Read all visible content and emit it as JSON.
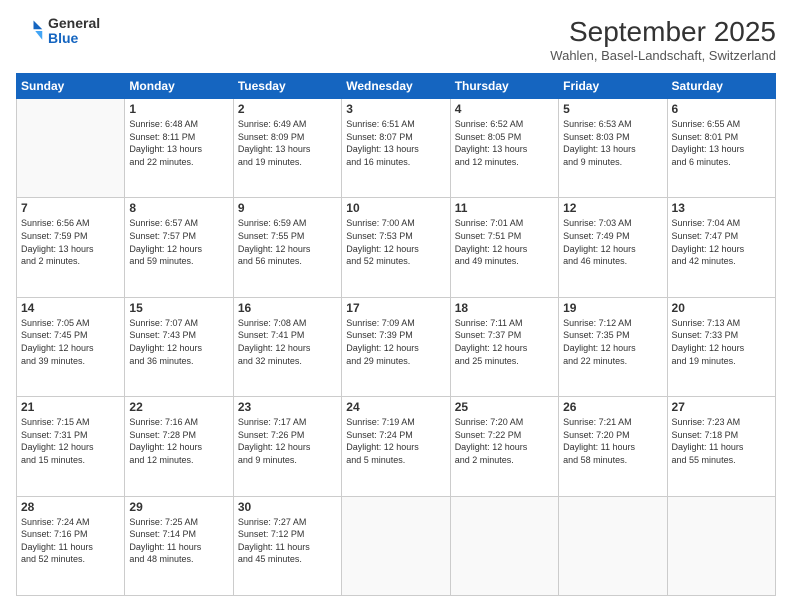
{
  "header": {
    "logo_general": "General",
    "logo_blue": "Blue",
    "month_title": "September 2025",
    "location": "Wahlen, Basel-Landschaft, Switzerland"
  },
  "columns": [
    "Sunday",
    "Monday",
    "Tuesday",
    "Wednesday",
    "Thursday",
    "Friday",
    "Saturday"
  ],
  "weeks": [
    [
      {
        "day": "",
        "info": ""
      },
      {
        "day": "1",
        "info": "Sunrise: 6:48 AM\nSunset: 8:11 PM\nDaylight: 13 hours\nand 22 minutes."
      },
      {
        "day": "2",
        "info": "Sunrise: 6:49 AM\nSunset: 8:09 PM\nDaylight: 13 hours\nand 19 minutes."
      },
      {
        "day": "3",
        "info": "Sunrise: 6:51 AM\nSunset: 8:07 PM\nDaylight: 13 hours\nand 16 minutes."
      },
      {
        "day": "4",
        "info": "Sunrise: 6:52 AM\nSunset: 8:05 PM\nDaylight: 13 hours\nand 12 minutes."
      },
      {
        "day": "5",
        "info": "Sunrise: 6:53 AM\nSunset: 8:03 PM\nDaylight: 13 hours\nand 9 minutes."
      },
      {
        "day": "6",
        "info": "Sunrise: 6:55 AM\nSunset: 8:01 PM\nDaylight: 13 hours\nand 6 minutes."
      }
    ],
    [
      {
        "day": "7",
        "info": "Sunrise: 6:56 AM\nSunset: 7:59 PM\nDaylight: 13 hours\nand 2 minutes."
      },
      {
        "day": "8",
        "info": "Sunrise: 6:57 AM\nSunset: 7:57 PM\nDaylight: 12 hours\nand 59 minutes."
      },
      {
        "day": "9",
        "info": "Sunrise: 6:59 AM\nSunset: 7:55 PM\nDaylight: 12 hours\nand 56 minutes."
      },
      {
        "day": "10",
        "info": "Sunrise: 7:00 AM\nSunset: 7:53 PM\nDaylight: 12 hours\nand 52 minutes."
      },
      {
        "day": "11",
        "info": "Sunrise: 7:01 AM\nSunset: 7:51 PM\nDaylight: 12 hours\nand 49 minutes."
      },
      {
        "day": "12",
        "info": "Sunrise: 7:03 AM\nSunset: 7:49 PM\nDaylight: 12 hours\nand 46 minutes."
      },
      {
        "day": "13",
        "info": "Sunrise: 7:04 AM\nSunset: 7:47 PM\nDaylight: 12 hours\nand 42 minutes."
      }
    ],
    [
      {
        "day": "14",
        "info": "Sunrise: 7:05 AM\nSunset: 7:45 PM\nDaylight: 12 hours\nand 39 minutes."
      },
      {
        "day": "15",
        "info": "Sunrise: 7:07 AM\nSunset: 7:43 PM\nDaylight: 12 hours\nand 36 minutes."
      },
      {
        "day": "16",
        "info": "Sunrise: 7:08 AM\nSunset: 7:41 PM\nDaylight: 12 hours\nand 32 minutes."
      },
      {
        "day": "17",
        "info": "Sunrise: 7:09 AM\nSunset: 7:39 PM\nDaylight: 12 hours\nand 29 minutes."
      },
      {
        "day": "18",
        "info": "Sunrise: 7:11 AM\nSunset: 7:37 PM\nDaylight: 12 hours\nand 25 minutes."
      },
      {
        "day": "19",
        "info": "Sunrise: 7:12 AM\nSunset: 7:35 PM\nDaylight: 12 hours\nand 22 minutes."
      },
      {
        "day": "20",
        "info": "Sunrise: 7:13 AM\nSunset: 7:33 PM\nDaylight: 12 hours\nand 19 minutes."
      }
    ],
    [
      {
        "day": "21",
        "info": "Sunrise: 7:15 AM\nSunset: 7:31 PM\nDaylight: 12 hours\nand 15 minutes."
      },
      {
        "day": "22",
        "info": "Sunrise: 7:16 AM\nSunset: 7:28 PM\nDaylight: 12 hours\nand 12 minutes."
      },
      {
        "day": "23",
        "info": "Sunrise: 7:17 AM\nSunset: 7:26 PM\nDaylight: 12 hours\nand 9 minutes."
      },
      {
        "day": "24",
        "info": "Sunrise: 7:19 AM\nSunset: 7:24 PM\nDaylight: 12 hours\nand 5 minutes."
      },
      {
        "day": "25",
        "info": "Sunrise: 7:20 AM\nSunset: 7:22 PM\nDaylight: 12 hours\nand 2 minutes."
      },
      {
        "day": "26",
        "info": "Sunrise: 7:21 AM\nSunset: 7:20 PM\nDaylight: 11 hours\nand 58 minutes."
      },
      {
        "day": "27",
        "info": "Sunrise: 7:23 AM\nSunset: 7:18 PM\nDaylight: 11 hours\nand 55 minutes."
      }
    ],
    [
      {
        "day": "28",
        "info": "Sunrise: 7:24 AM\nSunset: 7:16 PM\nDaylight: 11 hours\nand 52 minutes."
      },
      {
        "day": "29",
        "info": "Sunrise: 7:25 AM\nSunset: 7:14 PM\nDaylight: 11 hours\nand 48 minutes."
      },
      {
        "day": "30",
        "info": "Sunrise: 7:27 AM\nSunset: 7:12 PM\nDaylight: 11 hours\nand 45 minutes."
      },
      {
        "day": "",
        "info": ""
      },
      {
        "day": "",
        "info": ""
      },
      {
        "day": "",
        "info": ""
      },
      {
        "day": "",
        "info": ""
      }
    ]
  ]
}
